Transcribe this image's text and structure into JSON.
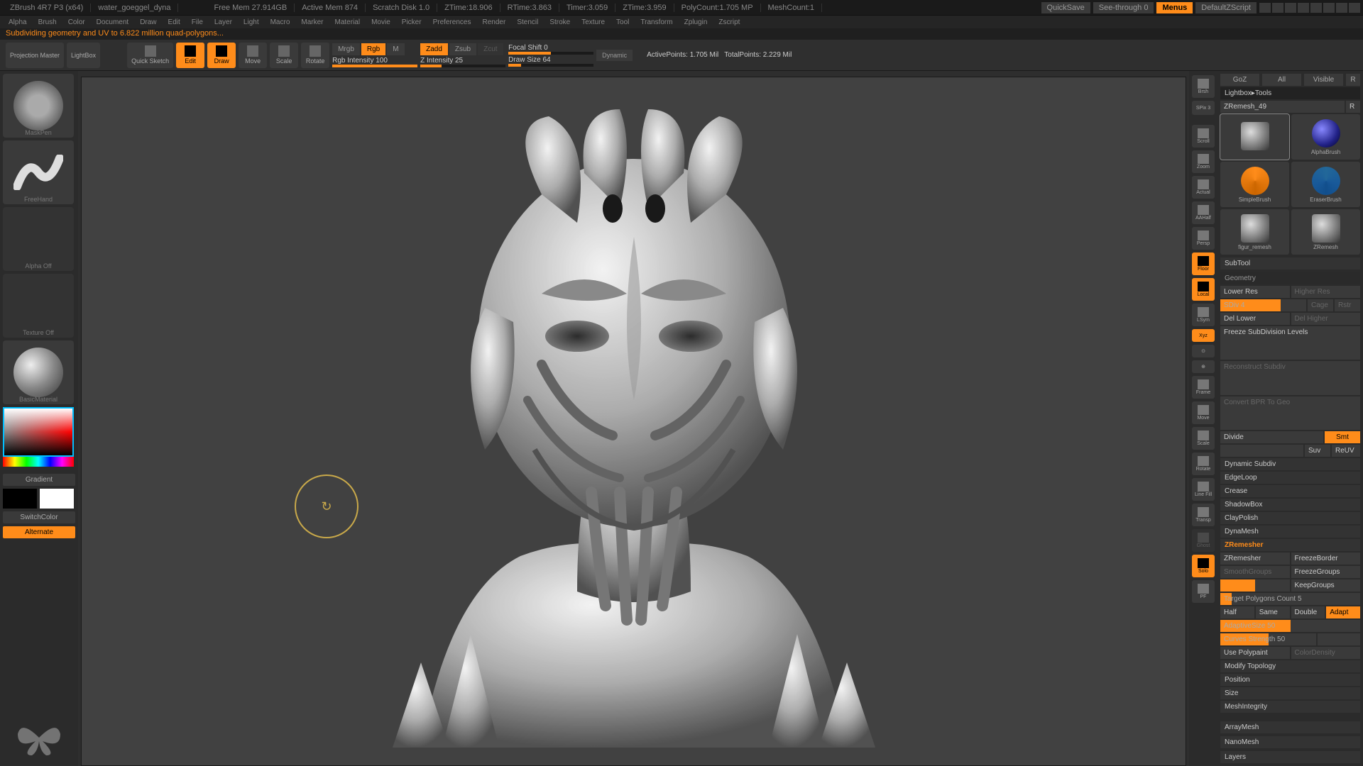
{
  "titlebar": {
    "app": "ZBrush 4R7 P3 (x64)",
    "file": "water_goeggel_dyna",
    "free_mem": "Free Mem 27.914GB",
    "active_mem": "Active Mem 874",
    "scratch": "Scratch Disk 1.0",
    "ztime": "ZTime:18.906",
    "rtime": "RTime:3.863",
    "timer": "Timer:3.059",
    "ztime2": "ZTime:3.959",
    "polycount": "PolyCount:1.705 MP",
    "meshcount": "MeshCount:1",
    "quicksave": "QuickSave",
    "seethrough": "See-through 0",
    "menus": "Menus",
    "script": "DefaultZScript"
  },
  "menubar": [
    "Alpha",
    "Brush",
    "Color",
    "Document",
    "Draw",
    "Edit",
    "File",
    "Layer",
    "Light",
    "Macro",
    "Marker",
    "Material",
    "Movie",
    "Picker",
    "Preferences",
    "Render",
    "Stencil",
    "Stroke",
    "Texture",
    "Tool",
    "Transform",
    "Zplugin",
    "Zscript"
  ],
  "status": "Subdividing geometry and UV to 6.822 million quad-polygons...",
  "toolbar": {
    "projection": "Projection Master",
    "lightbox": "LightBox",
    "quicksketch": "Quick Sketch",
    "edit": "Edit",
    "draw": "Draw",
    "move": "Move",
    "scale": "Scale",
    "rotate": "Rotate",
    "mrgb": "Mrgb",
    "rgb": "Rgb",
    "m": "M",
    "rgb_intensity": "Rgb Intensity 100",
    "zadd": "Zadd",
    "zsub": "Zsub",
    "zcut": "Zcut",
    "z_intensity": "Z Intensity 25",
    "focal": "Focal Shift 0",
    "draw_size": "Draw Size 64",
    "dynamic": "Dynamic",
    "active_points": "ActivePoints: 1.705 Mil",
    "total_points": "TotalPoints: 2.229 Mil"
  },
  "left": {
    "brush": "MaskPen",
    "stroke": "FreeHand",
    "alpha": "Alpha Off",
    "texture": "Texture Off",
    "material": "BasicMaterial",
    "gradient": "Gradient",
    "switch": "SwitchColor",
    "alternate": "Alternate"
  },
  "shelf": {
    "brsh": "Brsh",
    "spix": "SPix 3",
    "scroll": "Scroll",
    "zoom": "Zoom",
    "actual": "Actual",
    "aahalf": "AAHalf",
    "persp": "Persp",
    "floor": "Floor",
    "local": "Local",
    "lsym": "LSym",
    "xyz": "Xyz",
    "frame": "Frame",
    "move": "Move",
    "scale": "Scale",
    "rotate": "Rotate",
    "linefill": "Line Fill",
    "transp": "Transp",
    "ghost": "Ghost",
    "solo": "Solo",
    "pf": "PF"
  },
  "right": {
    "tabs": {
      "goz": "GoZ",
      "all": "All",
      "visible": "Visible",
      "r": "R"
    },
    "lightbox_tools": "Lightbox▸Tools",
    "tool_name": "ZRemesh_49",
    "r2": "R",
    "thumbs": [
      "",
      "AlphaBrush",
      "SimpleBrush",
      "EraserBrush",
      "figur_remesh",
      "ZRemesh"
    ],
    "subtool": "SubTool",
    "geometry": "Geometry",
    "lower_res": "Lower Res",
    "higher_res": "Higher Res",
    "sdiv": "SDiv 4",
    "cage": "Cage",
    "rstr": "Rstr",
    "del_lower": "Del Lower",
    "del_higher": "Del Higher",
    "freeze_sub": "Freeze SubDivision Levels",
    "reconstruct": "Reconstruct Subdiv",
    "convert_bpr": "Convert BPR To Geo",
    "divide": "Divide",
    "smt": "Smt",
    "suv": "Suv",
    "reuv": "ReUV",
    "dyn_subdiv": "Dynamic Subdiv",
    "edgeloop": "EdgeLoop",
    "crease": "Crease",
    "shadowbox": "ShadowBox",
    "claypolish": "ClayPolish",
    "dynamesh": "DynaMesh",
    "zremesher_h": "ZRemesher",
    "zremesher": "ZRemesher",
    "freezeborder": "FreezeBorder",
    "smoothgroups": "SmoothGroups",
    "freezegroups": "FreezeGroups",
    "keepgroups": "KeepGroups",
    "target_poly": "Target Polygons Count 5",
    "half": "Half",
    "same": "Same",
    "double": "Double",
    "adapt": "Adapt",
    "adaptive": "AdaptiveSize 50",
    "curves": "Curves Strength 50",
    "use_poly": "Use Polypaint",
    "colordensity": "ColorDensity",
    "modify_topo": "Modify Topology",
    "position": "Position",
    "size": "Size",
    "meshint": "MeshIntegrity",
    "arraymesh": "ArrayMesh",
    "nanomesh": "NanoMesh",
    "layers": "Layers"
  }
}
